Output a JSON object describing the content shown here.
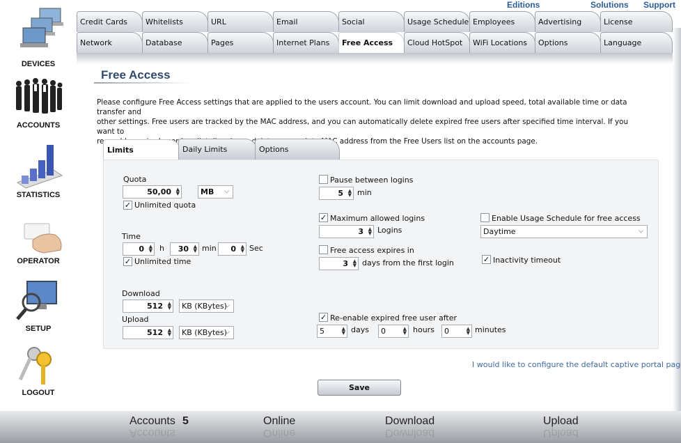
{
  "top_links": [
    "Editions",
    "Solutions",
    "Support"
  ],
  "sidebar": {
    "items": [
      {
        "label": "DEVICES",
        "icon": "laptops-icon"
      },
      {
        "label": "ACCOUNTS",
        "icon": "people-icon"
      },
      {
        "label": "STATISTICS",
        "icon": "bar-chart-icon"
      },
      {
        "label": "OPERATOR",
        "icon": "card-hand-icon"
      },
      {
        "label": "SETUP",
        "icon": "monitor-magnifier-icon"
      },
      {
        "label": "LOGOUT",
        "icon": "keys-icon"
      }
    ]
  },
  "tabs": {
    "row1": [
      "Credit Cards",
      "Whitelists",
      "URL",
      "Email",
      "Social",
      "Usage Schedule",
      "Employees",
      "Advertising",
      "License"
    ],
    "row2": [
      "Network",
      "Database",
      "Pages",
      "Internet Plans",
      "Free Access",
      "Cloud HotSpot",
      "WiFi Locations",
      "Options",
      "Language"
    ],
    "active": "Free Access"
  },
  "page": {
    "title": "Free Access",
    "description_lines": [
      "Please configure Free Access settings that are applied to the users account. You can limit download and upload speed, total available time or data transfer and",
      "other settings. Free users are tracked by the MAC address, and you can automatically delete expired free users after specified time interval. If you want to",
      "re-enable expired user imediatelly, please delete appropriate MAC address from the Free Users list on the accounts page."
    ]
  },
  "subtabs": {
    "items": [
      "Limits",
      "Daily Limits",
      "Options"
    ],
    "active": "Limits"
  },
  "limits": {
    "quota": {
      "label": "Quota",
      "value": "50,00",
      "unit": "MB",
      "unlimited_label": "Unlimited quota",
      "unlimited_checked": true
    },
    "time": {
      "label": "Time",
      "hours": "0",
      "hours_unit": "h",
      "minutes": "30",
      "minutes_unit": "min",
      "seconds": "0",
      "seconds_unit": "Sec",
      "unlimited_label": "Unlimited time",
      "unlimited_checked": true
    },
    "download": {
      "label": "Download",
      "value": "512",
      "unit": "KB (KBytes)"
    },
    "upload": {
      "label": "Upload",
      "value": "512",
      "unit": "KB (KBytes)"
    },
    "pause": {
      "label": "Pause between logins",
      "checked": false,
      "value": "5",
      "unit": "min"
    },
    "max_logins": {
      "label": "Maximum allowed logins",
      "checked": true,
      "value": "3",
      "unit": "Logins"
    },
    "expires": {
      "label": "Free access expires in",
      "checked": false,
      "value": "3",
      "unit": "days from the first login"
    },
    "reenable": {
      "label": "Re-enable expired free user after",
      "checked": true,
      "days": "5",
      "days_unit": "days",
      "hours": "0",
      "hours_unit": "hours",
      "minutes": "0",
      "minutes_unit": "minutes"
    },
    "usage_schedule": {
      "label": "Enable Usage Schedule for free access",
      "checked": false,
      "selected": "Daytime"
    },
    "inactivity": {
      "label": "Inactivity timeout",
      "checked": true
    }
  },
  "portal_link": "I would like to configure the default captive portal page",
  "save_label": "Save",
  "footer": {
    "accounts_label": "Accounts",
    "accounts_value": "5",
    "online_label": "Online",
    "download_label": "Download",
    "upload_label": "Upload"
  },
  "colors": {
    "link": "#2b5d9b",
    "title": "#2f4a6e",
    "panel": "#f3f4f6"
  }
}
